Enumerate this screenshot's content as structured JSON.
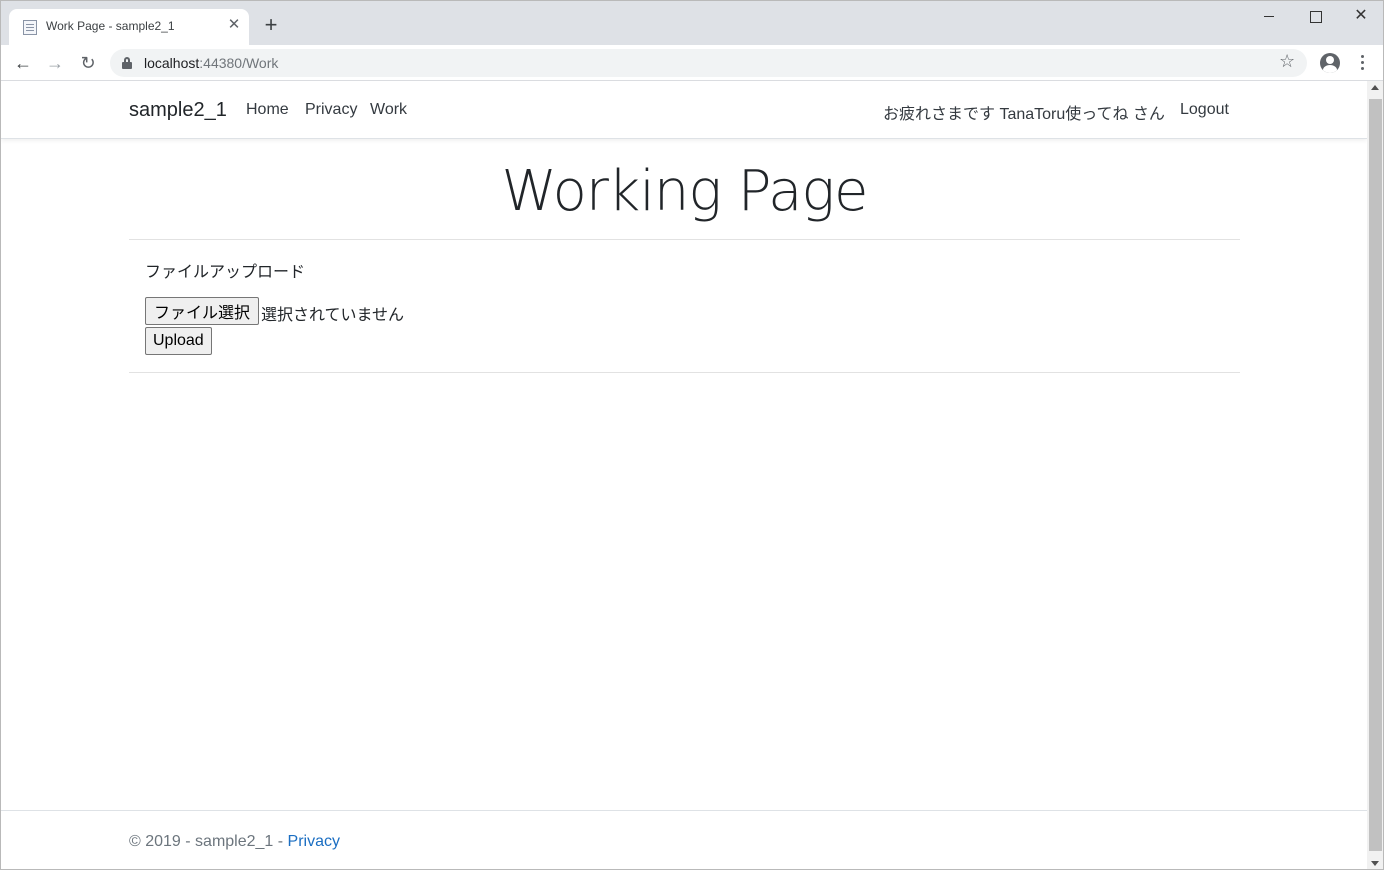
{
  "browser": {
    "tab_title": "Work Page - sample2_1",
    "url_host": "localhost",
    "url_path": ":44380/Work"
  },
  "navbar": {
    "brand": "sample2_1",
    "links": [
      "Home",
      "Privacy",
      "Work"
    ],
    "greeting": "お疲れさまです TanaToru使ってね さん",
    "logout": "Logout"
  },
  "main": {
    "title": "Working Page",
    "upload_label": "ファイルアップロード",
    "file_button": "ファイル選択",
    "file_status": "選択されていません",
    "upload_button": "Upload"
  },
  "footer": {
    "text": "© 2019 - sample2_1 - ",
    "link": "Privacy"
  },
  "colors": {
    "link": "#1b6ec2",
    "text": "#212529",
    "tabstrip": "#dee1e6"
  }
}
